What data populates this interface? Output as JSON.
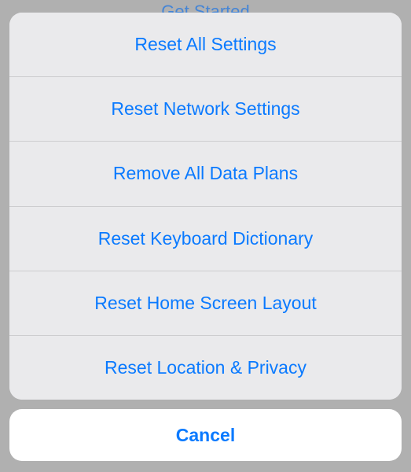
{
  "background_hint": "Get Started",
  "options": [
    {
      "label": "Reset All Settings"
    },
    {
      "label": "Reset Network Settings"
    },
    {
      "label": "Remove All Data Plans"
    },
    {
      "label": "Reset Keyboard Dictionary"
    },
    {
      "label": "Reset Home Screen Layout"
    },
    {
      "label": "Reset Location & Privacy"
    }
  ],
  "cancel_label": "Cancel",
  "colors": {
    "accent": "#0a7aff",
    "sheet_bg": "#eaeaec",
    "cancel_bg": "#ffffff",
    "backdrop": "#b0b0b0"
  }
}
